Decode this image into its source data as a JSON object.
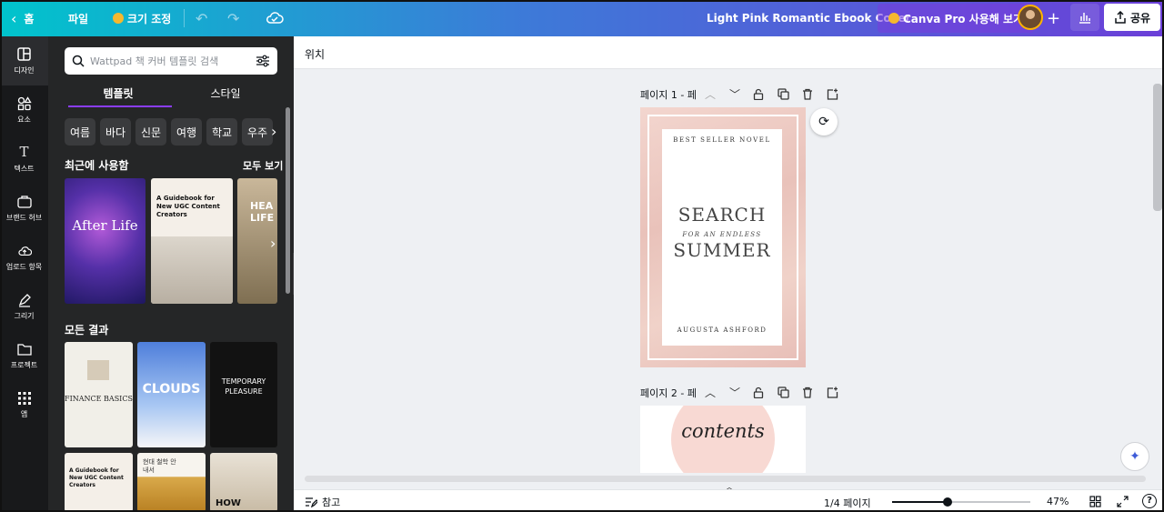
{
  "topbar": {
    "home": "홈",
    "file": "파일",
    "resize": "크기 조정",
    "doc_title": "Light Pink Romantic Ebook Cover",
    "pro_button": "Canva Pro 사용해 보기",
    "share": "공유",
    "plus": "+",
    "icons": [
      "chevron-left-icon",
      "undo-icon",
      "redo-icon",
      "cloud-saved-icon",
      "crown-icon",
      "bar-chart-icon",
      "share-upload-icon"
    ]
  },
  "rail": {
    "items": [
      {
        "label": "디자인",
        "icon": "design-icon"
      },
      {
        "label": "요소",
        "icon": "elements-icon"
      },
      {
        "label": "텍스트",
        "icon": "text-icon"
      },
      {
        "label": "브랜드 허브",
        "icon": "brand-icon"
      },
      {
        "label": "업로드 항목",
        "icon": "upload-icon"
      },
      {
        "label": "그리기",
        "icon": "draw-icon"
      },
      {
        "label": "프로젝트",
        "icon": "folder-icon"
      },
      {
        "label": "앱",
        "icon": "apps-icon"
      }
    ]
  },
  "panel": {
    "search_placeholder": "Wattpad 책 커버 템플릿 검색",
    "tabs": [
      "템플릿",
      "스타일"
    ],
    "chips": [
      "여름",
      "바다",
      "신문",
      "여행",
      "학교",
      "우주"
    ],
    "recent_title": "최근에 사용함",
    "see_all": "모두 보기",
    "all_results_title": "모든 결과",
    "recent": {
      "after_life": "After Life",
      "guidebook": "A Guidebook for New UGC Content Creators",
      "health": "HEA LIFE"
    },
    "results": {
      "finance": "FINANCE BASICS",
      "clouds": "CLOUDS",
      "temporary": "TEMPORARY PLEASURE",
      "guidebook2": "A Guidebook for New UGC Content Creators",
      "korean": "현대 철학 안내서",
      "how": "HOW"
    }
  },
  "canvas": {
    "position_label": "위치",
    "page1_label": "페이지 1 - 페",
    "page2_label": "페이지 2 - 페",
    "cover": {
      "top": "BEST SELLER NOVEL",
      "title1": "SEARCH",
      "subtitle": "FOR AN ENDLESS",
      "title2": "SUMMER",
      "author": "AUGUSTA ASHFORD"
    },
    "page2_text": "contents"
  },
  "bottom": {
    "notes": "참고",
    "page_count": "1/4 페이지",
    "zoom": "47%",
    "zoom_level": 0.4
  }
}
